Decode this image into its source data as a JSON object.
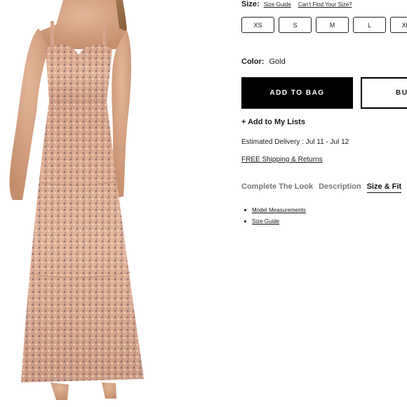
{
  "product": {
    "image_alt": "gold sequin tulle gown"
  },
  "size": {
    "label": "Size:",
    "size_guide_link": "Size Guide",
    "cant_find_link": "Can't Find Your Size?",
    "options": [
      "XS",
      "S",
      "M",
      "L",
      "XL"
    ]
  },
  "color": {
    "label": "Color:",
    "value": "Gold"
  },
  "actions": {
    "add_to_bag": "ADD TO BAG",
    "buy_now": "BU"
  },
  "add_to_list": "+ Add to My Lists",
  "delivery": "Estimated Delivery : Jul 11 - Jul 12",
  "shipping": "FREE Shipping & Returns",
  "tabs": [
    {
      "label": "Complete The Look",
      "active": false
    },
    {
      "label": "Description",
      "active": false
    },
    {
      "label": "Size & Fit",
      "active": true
    }
  ],
  "size_fit_links": [
    "Model Measurements",
    "Size Guide"
  ],
  "colors": {
    "accent": "#000000",
    "gown": "#d9a98a",
    "sequin": "#8c6e6e"
  }
}
